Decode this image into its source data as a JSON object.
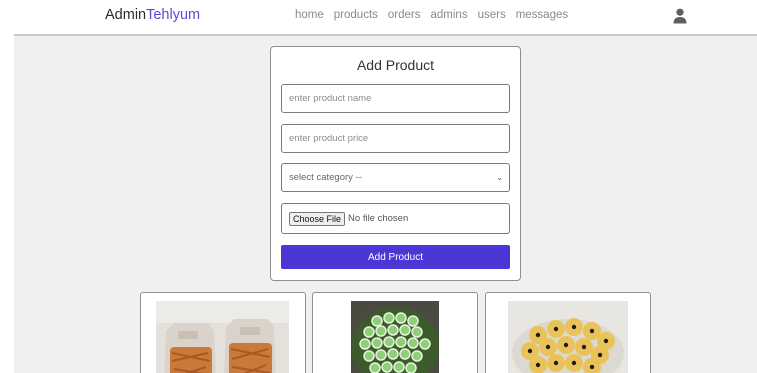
{
  "header": {
    "logo_part1": "Admin",
    "logo_part2": "Tehlyum",
    "nav": [
      "home",
      "products",
      "orders",
      "admins",
      "users",
      "messages"
    ],
    "user_icon": "user-icon"
  },
  "form": {
    "title": "Add Product",
    "name_placeholder": "enter product name",
    "price_placeholder": "enter product price",
    "category_selected": "select category --",
    "file_button": "Choose File",
    "file_status": "No file chosen",
    "submit_label": "Add Product"
  },
  "colors": {
    "accent": "#4b37d6",
    "logo_accent": "#5b4bd6",
    "background": "#f0f0f0"
  },
  "products": [
    {
      "image": "fried-snack-bags-photo"
    },
    {
      "image": "green-round-cookies-tray-photo"
    },
    {
      "image": "yellow-flower-cookies-photo"
    }
  ]
}
